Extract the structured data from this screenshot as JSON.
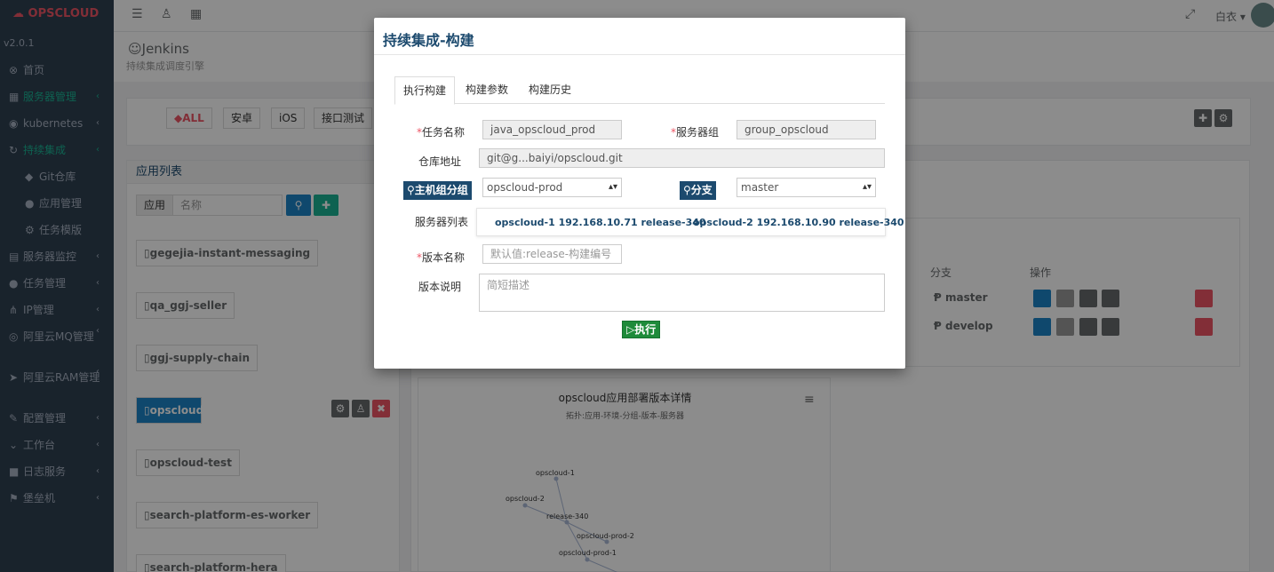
{
  "sidebar": {
    "logo": "OPSCLOUD",
    "version": "v2.0.1",
    "items": [
      {
        "icon": "home-icon",
        "glyph": "⊗",
        "label": "首页",
        "arrow": false
      },
      {
        "icon": "grid-icon",
        "glyph": "▦",
        "label": "服务器管理",
        "arrow": true,
        "active": true
      },
      {
        "icon": "kubernetes-icon",
        "glyph": "◉",
        "label": "kubernetes",
        "arrow": true
      },
      {
        "icon": "ci-icon",
        "glyph": "↻",
        "label": "持续集成",
        "arrow": true,
        "active": true
      },
      {
        "icon": "git-icon",
        "glyph": "◆",
        "label": "Git仓库",
        "sub": true
      },
      {
        "icon": "app-icon",
        "glyph": "●",
        "label": "应用管理",
        "sub": true
      },
      {
        "icon": "template-icon",
        "glyph": "⚙",
        "label": "任务模版",
        "sub": true
      },
      {
        "icon": "monitor-icon",
        "glyph": "▤",
        "label": "服务器监控",
        "arrow": true
      },
      {
        "icon": "task-icon",
        "glyph": "●",
        "label": "任务管理",
        "arrow": true
      },
      {
        "icon": "ip-icon",
        "glyph": "⋔",
        "label": "IP管理",
        "arrow": true
      },
      {
        "icon": "mq-icon",
        "glyph": "◎",
        "label": "阿里云MQ管理",
        "arrow": true,
        "two": true
      },
      {
        "icon": "ram-icon",
        "glyph": "➤",
        "label": "阿里云RAM管理",
        "arrow": true,
        "two": true
      },
      {
        "icon": "config-icon",
        "glyph": "✎",
        "label": "配置管理",
        "arrow": true
      },
      {
        "icon": "workbench-icon",
        "glyph": "⌄",
        "label": "工作台",
        "arrow": true
      },
      {
        "icon": "log-icon",
        "glyph": "■",
        "label": "日志服务",
        "arrow": true
      },
      {
        "icon": "bastion-icon",
        "glyph": "⚑",
        "label": "堡垒机",
        "arrow": true
      }
    ]
  },
  "topbar": {
    "user": "白衣 ▾"
  },
  "page": {
    "title": "Jenkins",
    "subtitle": "持续集成调度引擎"
  },
  "filters": [
    "ALL",
    "安卓",
    "iOS",
    "接口测试"
  ],
  "app_list": {
    "title": "应用列表",
    "search_prefix": "应用",
    "search_placeholder": "名称",
    "apps": [
      "gegejia-instant-messaging",
      "qa_ggj-seller",
      "ggj-supply-chain",
      "opscloud",
      "opscloud-test",
      "search-platform-es-worker",
      "search-platform-hera"
    ]
  },
  "branch_table": {
    "headers": [
      "分支",
      "操作"
    ],
    "rows": [
      "master",
      "develop"
    ]
  },
  "chart": {
    "title": "opscloud应用部署版本详情",
    "subtitle": "拓扑:应用-环境-分组-版本-服务器",
    "nodes": [
      "opscloud-1",
      "opscloud-2",
      "release-340",
      "opscloud-prod-2",
      "opscloud-prod-1"
    ]
  },
  "modal": {
    "title": "持续集成-构建",
    "tabs": [
      "执行构建",
      "构建参数",
      "构建历史"
    ],
    "labels": {
      "task_name": "任务名称",
      "server_group": "服务器组",
      "repo": "仓库地址",
      "host_group_btn": "主机组分组",
      "branch_btn": "分支",
      "server_list": "服务器列表",
      "version_name": "版本名称",
      "version_desc": "版本说明",
      "required_mark": "*"
    },
    "values": {
      "task_name": "java_opscloud_prod",
      "server_group": "group_opscloud",
      "repo": "git@g...baiyi/opscloud.git",
      "host_group": "opscloud-prod",
      "branch": "master"
    },
    "servers": [
      "opscloud-1 192.168.10.71 release-340",
      "opscloud-2 192.168.10.90 release-340"
    ],
    "placeholders": {
      "version_name": "默认值:release-构建编号",
      "version_desc": "简短描述"
    },
    "execute_label": "▷执行"
  }
}
